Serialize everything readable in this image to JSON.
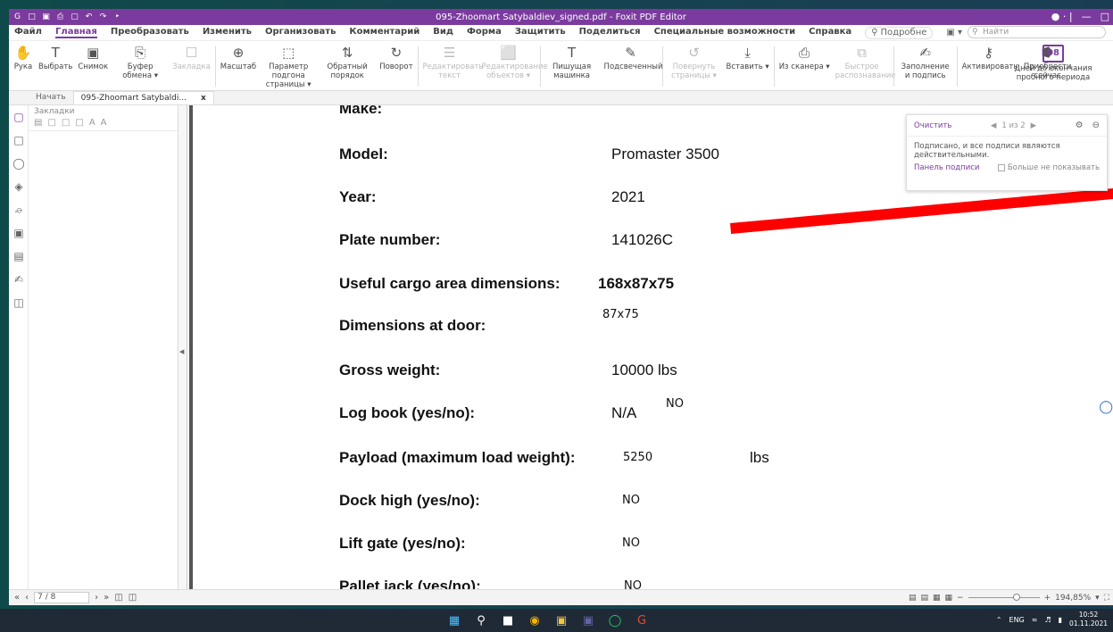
{
  "window": {
    "title": "095-Zhoomart Satybaldiev_signed.pdf - Foxit PDF Editor",
    "controls": [
      "⦿ · |",
      "—",
      "ə"
    ]
  },
  "menu": {
    "items": [
      "Файл",
      "Главная",
      "Преобразовать",
      "Изменить",
      "Организовать",
      "Комментарий",
      "Вид",
      "Форма",
      "Защитить",
      "Поделиться",
      "Специальные возможности",
      "Справка"
    ],
    "active_index": 1,
    "more_label": "Подробне",
    "search_placeholder": "Найти"
  },
  "ribbon": {
    "tools": [
      {
        "label": "Рука",
        "icon": "✋",
        "name": "hand-tool",
        "disabled": false
      },
      {
        "label": "Выбрать",
        "icon": "T",
        "name": "select-tool",
        "disabled": false
      },
      {
        "label": "Снимок",
        "icon": "▣",
        "name": "snapshot-tool",
        "disabled": false
      },
      {
        "label": "Буфер обмена ▾",
        "icon": "⎘",
        "name": "clipboard-tool",
        "disabled": false
      },
      {
        "label": "Закладка",
        "icon": "☐",
        "name": "bookmark-tool",
        "disabled": true
      },
      {
        "label": "Масштаб",
        "icon": "⊕",
        "name": "zoom-tool",
        "disabled": false
      },
      {
        "label": "Параметр подгона страницы ▾",
        "icon": "⬚",
        "name": "fit-page-tool",
        "disabled": false
      },
      {
        "label": "Обратный порядок",
        "icon": "⇅",
        "name": "reverse-order-tool",
        "disabled": false
      },
      {
        "label": "Поворот",
        "icon": "↻",
        "name": "rotate-tool",
        "disabled": false
      },
      {
        "label": "Редактировать текст",
        "icon": "☰",
        "name": "edit-text-tool",
        "disabled": true
      },
      {
        "label": "Редактирование объектов ▾",
        "icon": "⬜",
        "name": "edit-objects-tool",
        "disabled": true
      },
      {
        "label": "Пишущая машинка",
        "icon": "T",
        "name": "typewriter-tool",
        "disabled": false
      },
      {
        "label": "Подсвеченный",
        "icon": "✎",
        "name": "highlight-tool",
        "disabled": false
      },
      {
        "label": "Повернуть страницы ▾",
        "icon": "↺",
        "name": "rotate-pages-tool",
        "disabled": true
      },
      {
        "label": "Вставить ▾",
        "icon": "⤓",
        "name": "insert-tool",
        "disabled": false
      },
      {
        "label": "Из сканера ▾",
        "icon": "⎙",
        "name": "scanner-tool",
        "disabled": false
      },
      {
        "label": "Быстрое распознавание",
        "icon": "⧉",
        "name": "ocr-tool",
        "disabled": true
      },
      {
        "label": "Заполнение и подпись",
        "icon": "✍",
        "name": "fill-sign-tool",
        "disabled": false
      },
      {
        "label": "Активировать",
        "icon": "⚷",
        "name": "activate-tool",
        "disabled": false
      },
      {
        "label": "Приобрести сейчас",
        "icon": "⭓",
        "name": "buy-tool",
        "disabled": false
      }
    ],
    "trial_days": "08",
    "trial_label": "Дней до окончания пробного периода"
  },
  "tabs": [
    {
      "label": "Начать",
      "active": false
    },
    {
      "label": "095-Zhoomart Satybaldi...",
      "active": true,
      "close": "x"
    }
  ],
  "bookmarks": {
    "title": "Закладки"
  },
  "document": {
    "rows": [
      {
        "label": "Model:",
        "value": "Promaster 3500"
      },
      {
        "label": "Year:",
        "value": "2021"
      },
      {
        "label": "Plate number:",
        "value": "141026C"
      },
      {
        "label": "Useful cargo area dimensions:",
        "value": "168x87x75"
      },
      {
        "label": "Dimensions at door:",
        "value": "87x75"
      },
      {
        "label": "Gross weight:",
        "value": "10000 lbs"
      },
      {
        "label": "Log book (yes/no):",
        "value": "N/A",
        "extra": "NO"
      },
      {
        "label": "Payload (maximum load weight):",
        "value": "5250",
        "extra": "lbs"
      },
      {
        "label": "Dock high (yes/no):",
        "value": "NO"
      },
      {
        "label": "Lift gate (yes/no):",
        "value": "NO"
      },
      {
        "label": "Pallet jack (yes/no):",
        "value": "NO"
      }
    ]
  },
  "signature_popup": {
    "clear_label": "Очистить",
    "nav": "1 из 2",
    "message": "Подписано, и все подписи являются действительными.",
    "panel_link": "Панель подписи",
    "dont_show": "Больше не показывать"
  },
  "status": {
    "page": "7 / 8",
    "zoom": "194,85%"
  },
  "taskbar": {
    "lang": "ENG",
    "time": "10:52",
    "date": "01.11.2021"
  }
}
